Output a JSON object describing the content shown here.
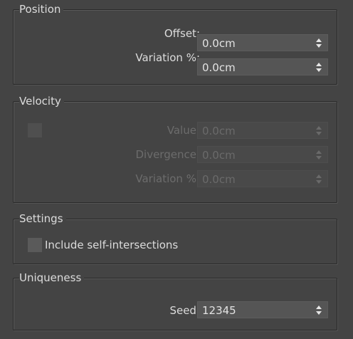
{
  "groups": {
    "position": {
      "title": "Position",
      "offset": {
        "label": "Offset:",
        "value": "0.0cm"
      },
      "variation": {
        "label": "Variation %:",
        "value": "0.0cm"
      }
    },
    "velocity": {
      "title": "Velocity",
      "enable_checked": false,
      "value": {
        "label": "Value:",
        "value": "0.0cm"
      },
      "divergence": {
        "label": "Divergence:",
        "value": "0.0cm"
      },
      "variation": {
        "label": "Variation %:",
        "value": "0.0cm"
      }
    },
    "settings": {
      "title": "Settings",
      "include_self_intersections": {
        "label": "Include self-intersections",
        "checked": false
      }
    },
    "uniqueness": {
      "title": "Uniqueness",
      "seed": {
        "label": "Seed:",
        "value": "12345"
      }
    }
  },
  "icons": {
    "spinner": "spinner-arrows-icon"
  },
  "colors": {
    "panel_bg": "#444444",
    "text": "#dcdcdc",
    "disabled_text": "#6c6c6c",
    "field_bg": "#555555"
  }
}
